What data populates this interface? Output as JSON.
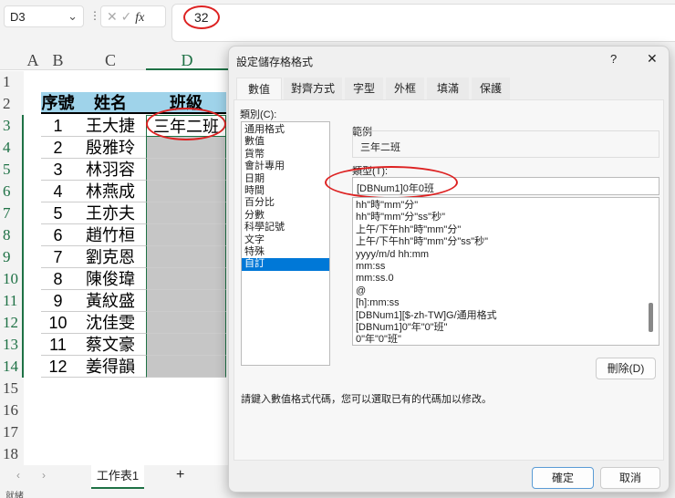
{
  "formula_bar": {
    "name_box": "D3",
    "formula": "32",
    "fx_label": "fx"
  },
  "columns": [
    "A",
    "B",
    "C",
    "D"
  ],
  "rows": [
    "1",
    "2",
    "3",
    "4",
    "5",
    "6",
    "7",
    "8",
    "9",
    "10",
    "11",
    "12",
    "13",
    "14",
    "15",
    "16",
    "17",
    "18"
  ],
  "table": {
    "headers": [
      "序號",
      "姓名",
      "班級"
    ],
    "rows": [
      [
        "1",
        "王大捷",
        "三年二班"
      ],
      [
        "2",
        "殷雅玲",
        ""
      ],
      [
        "3",
        "林羽容",
        ""
      ],
      [
        "4",
        "林燕成",
        ""
      ],
      [
        "5",
        "王亦夫",
        ""
      ],
      [
        "6",
        "趙竹桓",
        ""
      ],
      [
        "7",
        "劉克恩",
        ""
      ],
      [
        "8",
        "陳俊瑋",
        ""
      ],
      [
        "9",
        "黃紋盛",
        ""
      ],
      [
        "10",
        "沈佳雯",
        ""
      ],
      [
        "11",
        "蔡文豪",
        ""
      ],
      [
        "12",
        "姜得韻",
        ""
      ]
    ]
  },
  "sheet_tabs": {
    "active": "工作表1",
    "add": "+"
  },
  "status": "就緒",
  "dialog": {
    "title": "設定儲存格格式",
    "help": "?",
    "close": "✕",
    "tabs": [
      "數值",
      "對齊方式",
      "字型",
      "外框",
      "填滿",
      "保護"
    ],
    "category_label": "類別(C):",
    "categories": [
      "通用格式",
      "數值",
      "貨幣",
      "會計專用",
      "日期",
      "時間",
      "百分比",
      "分數",
      "科學記號",
      "文字",
      "特殊",
      "自訂"
    ],
    "selected_category": "自訂",
    "sample_label": "範例",
    "sample_value": "三年二班",
    "type_label": "類型(T):",
    "type_value": "[DBNum1]0年0班",
    "formats": [
      "hh\"時\"mm\"分\"",
      "hh\"時\"mm\"分\"ss\"秒\"",
      "上午/下午hh\"時\"mm\"分\"",
      "上午/下午hh\"時\"mm\"分\"ss\"秒\"",
      "yyyy/m/d hh:mm",
      "mm:ss",
      "mm:ss.0",
      "@",
      "[h]:mm:ss",
      "[DBNum1][$-zh-TW]G/通用格式",
      "[DBNum1]0\"年\"0\"班\"",
      "0\"年\"0\"班\""
    ],
    "delete": "刪除(D)",
    "hint": "請鍵入數值格式代碼，您可以選取已有的代碼加以修改。",
    "ok": "確定",
    "cancel": "取消"
  }
}
